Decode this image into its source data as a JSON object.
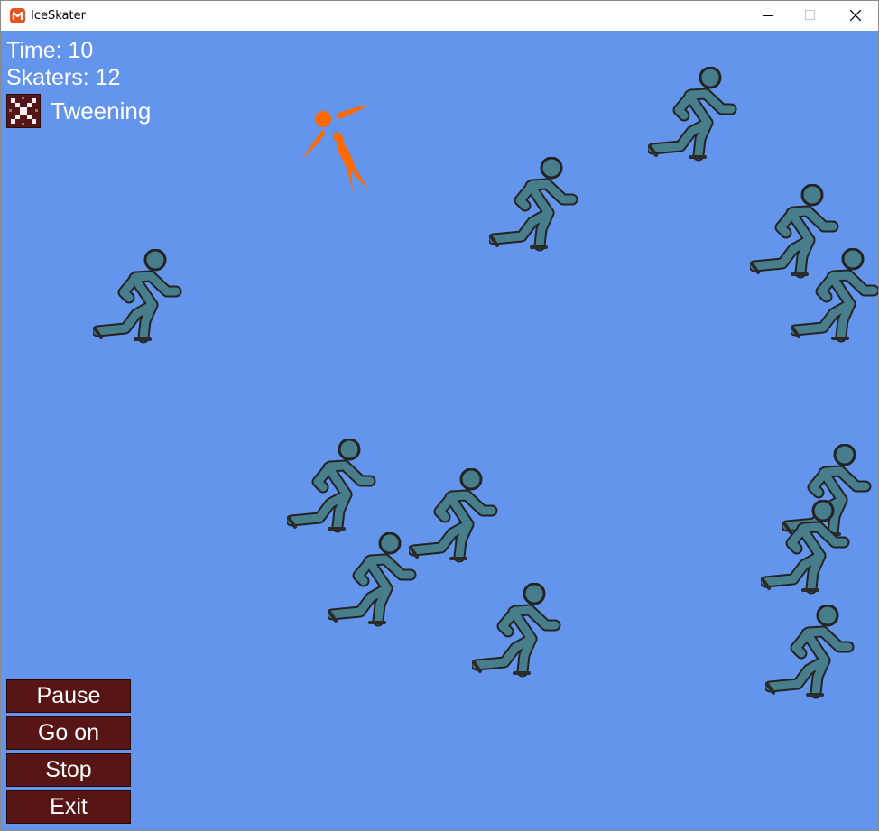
{
  "window": {
    "title": "IceSkater"
  },
  "hud": {
    "time": "Time: 10",
    "skaters": "Skaters: 12",
    "mode": "Tweening"
  },
  "buttons": {
    "pause": "Pause",
    "go_on": "Go on",
    "stop": "Stop",
    "exit": "Exit"
  },
  "colors": {
    "ice": "#6495ed",
    "skater": "#487d8c",
    "player": "#ff6a00",
    "button": "#571515",
    "text": "#ffffff"
  },
  "icons": {
    "app": "monogame-icon",
    "mode": "cross-pattern-icon",
    "skater": "skater-figure-icon",
    "player": "player-skater-icon"
  }
}
